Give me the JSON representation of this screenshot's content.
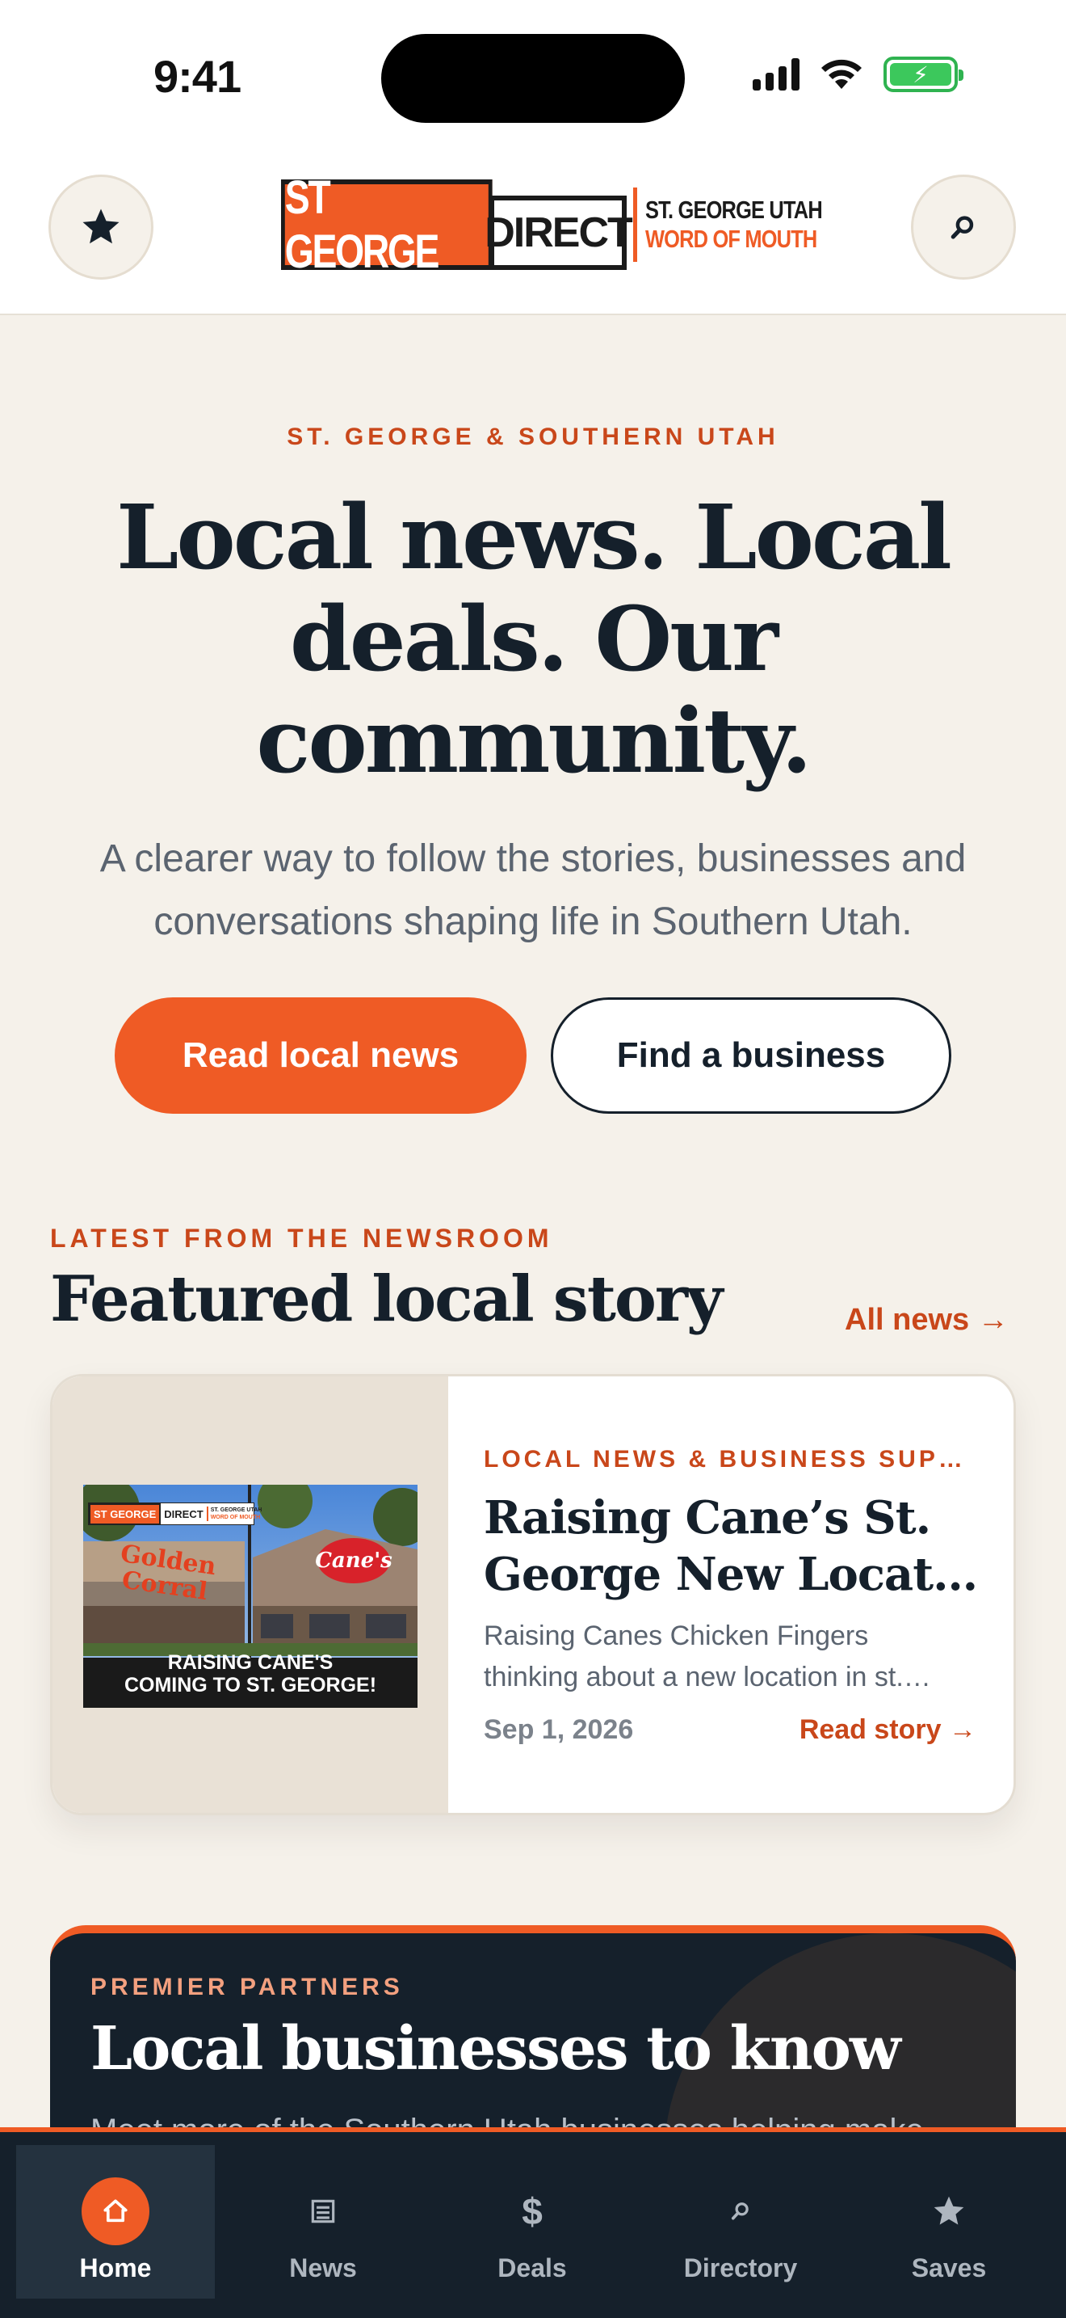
{
  "status_bar": {
    "time": "9:41"
  },
  "header": {
    "logo": {
      "brand_part1": "ST GEORGE",
      "brand_part2": "DIRECT",
      "tagline_line1": "ST. GEORGE UTAH",
      "tagline_line2": "WORD OF MOUTH"
    },
    "left_icon": "star-icon",
    "right_icon": "search-icon"
  },
  "hero": {
    "eyebrow": "ST. GEORGE & SOUTHERN UTAH",
    "title_lines": [
      "Local news. Local",
      "deals. Our",
      "community."
    ],
    "subtitle_lines": [
      "A clearer way to follow the stories, businesses and",
      "conversations shaping life in Southern Utah."
    ],
    "primary_button": "Read local news",
    "secondary_button": "Find a business"
  },
  "featured": {
    "eyebrow": "LATEST FROM THE NEWSROOM",
    "title": "Featured local story",
    "all_news": "All news →",
    "story": {
      "category": "LOCAL NEWS & BUSINESS SUP…",
      "title_lines": [
        "Raising Cane’s St.",
        "George New Locati…"
      ],
      "excerpt_lines": [
        "Raising Canes Chicken Fingers",
        "thinking about a new location in st.…"
      ],
      "date": "Sep 1, 2026",
      "read_story": "Read story →",
      "thumbnail": {
        "caption_line1": "RAISING CANE'S",
        "caption_line2": "COMING TO ST. GEORGE!",
        "sign_left": "Golden Corral",
        "sign_right": "Cane's",
        "badge_part1": "ST GEORGE",
        "badge_part2": "DIRECT",
        "badge_tagline_line1": "ST. GEORGE UTAH",
        "badge_tagline_line2": "WORD OF MOUTH"
      }
    }
  },
  "partners": {
    "eyebrow": "PREMIER PARTNERS",
    "title": "Local businesses to know",
    "subtitle": "Meet more of the Southern Utah businesses helping make"
  },
  "tabbar": {
    "tabs": [
      {
        "label": "Home",
        "icon": "home-icon",
        "active": true
      },
      {
        "label": "News",
        "icon": "newspaper-icon",
        "active": false
      },
      {
        "label": "Deals",
        "icon": "dollar-icon",
        "active": false
      },
      {
        "label": "Directory",
        "icon": "search-icon",
        "active": false
      },
      {
        "label": "Saves",
        "icon": "star-icon",
        "active": false
      }
    ]
  },
  "colors": {
    "accent": "#ef5b25",
    "accent_text": "#c9471a",
    "ink": "#15202b",
    "background": "#f5f1ea"
  }
}
